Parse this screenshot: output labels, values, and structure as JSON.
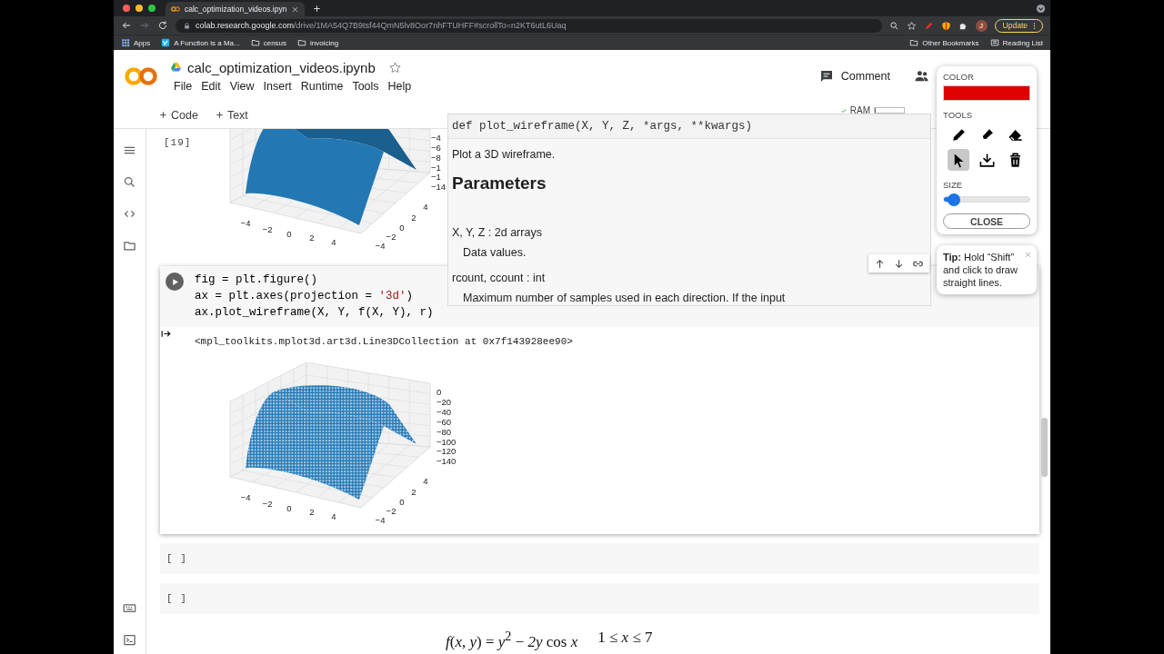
{
  "browser": {
    "tab_title": "calc_optimization_videos.ipyn",
    "url_host": "colab.research.google.com",
    "url_path": "/drive/1MA54Q7B9tsf44QmN5lv8Oor7nhFTUHFF#scrollTo=n2KT6utL6Uaq",
    "profile_initial": "J",
    "update_button": "Update",
    "bookmarks": [
      {
        "kind": "apps",
        "label": "Apps"
      },
      {
        "kind": "site",
        "label": "A Function is a Ma..."
      },
      {
        "kind": "folder",
        "label": "census"
      },
      {
        "kind": "folder",
        "label": "invoicing"
      }
    ],
    "right_bookmarks": [
      {
        "kind": "folder",
        "label": "Other Bookmarks"
      },
      {
        "kind": "list",
        "label": "Reading List"
      }
    ]
  },
  "notebook": {
    "title": "calc_optimization_videos.ipynb",
    "menu": [
      "File",
      "Edit",
      "View",
      "Insert",
      "Runtime",
      "Tools",
      "Help"
    ],
    "comment_button": "Comment",
    "toolbar": [
      {
        "label": "Code"
      },
      {
        "label": "Text"
      }
    ],
    "ram": {
      "label": "RAM",
      "level": 0.03
    }
  },
  "cells": [
    {
      "kind": "output",
      "execution_count": "[19]",
      "plot": {
        "kind": "surface",
        "x_ticks": [
          "−4",
          "−2",
          "0",
          "2",
          "4"
        ],
        "y_ticks": [
          "−4",
          "−2",
          "0",
          "2",
          "4"
        ],
        "z_ticks": [
          "−4",
          "−6",
          "−8",
          "−1",
          "−1",
          "−14"
        ]
      }
    },
    {
      "kind": "code",
      "lines": [
        "fig = plt.figure()",
        "ax = plt.axes(projection = '3d')",
        "ax.plot_wireframe(X, Y, f(X, Y), r)"
      ],
      "output_text": "<mpl_toolkits.mplot3d.art3d.Line3DCollection at 0x7f143928ee90>",
      "plot": {
        "kind": "wireframe",
        "x_ticks": [
          "−4",
          "−2",
          "0",
          "2",
          "4"
        ],
        "y_ticks": [
          "−4",
          "−2",
          "0",
          "2",
          "4"
        ],
        "z_ticks": [
          "0",
          "−20",
          "−40",
          "−60",
          "−80",
          "−100",
          "−120",
          "−140"
        ]
      }
    },
    {
      "kind": "empty",
      "prompt": "[ ]"
    },
    {
      "kind": "empty",
      "prompt": "[ ]"
    },
    {
      "kind": "math",
      "formula": "*f*(*x*, *y*) = *y*$^{2}$ − *2y* cos *x*",
      "range": "1 ≤ *x* ≤ 7"
    }
  ],
  "tooltip": {
    "signature": "def plot_wireframe(X, Y, Z, *args, **kwargs)",
    "summary": "Plot a 3D wireframe.",
    "heading": "Parameters",
    "params": [
      {
        "name": "X, Y, Z : 2d arrays",
        "description": "Data values."
      },
      {
        "name": "rcount, ccount : int",
        "description": "Maximum number of samples used in each direction.  If the input"
      }
    ]
  },
  "annotation_tools": {
    "color_label": "COLOR",
    "color": "#e00000",
    "tools_label": "TOOLS",
    "tools": [
      {
        "kind": "pen",
        "selected": false
      },
      {
        "kind": "highlighter",
        "selected": false
      },
      {
        "kind": "eraser",
        "selected": false
      },
      {
        "kind": "pointer",
        "selected": true
      },
      {
        "kind": "download",
        "selected": false
      },
      {
        "kind": "delete",
        "selected": false
      }
    ],
    "size": {
      "label": "SIZE",
      "level": 0.12
    },
    "close_button": "CLOSE"
  },
  "tip": {
    "text": "**Tip:** Hold “Shift” and click to draw straight lines."
  }
}
